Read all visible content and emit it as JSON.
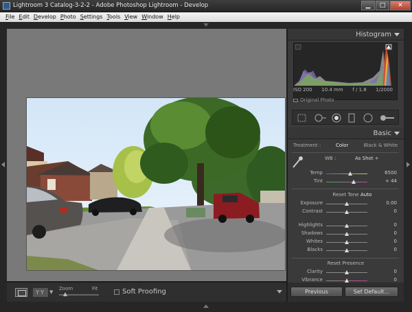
{
  "window": {
    "title": "Lightroom 3 Catalog-3-2-2 - Adobe Photoshop Lightroom - Develop",
    "minimize": "▁",
    "maximize": "□",
    "close": "✕"
  },
  "menu": [
    {
      "label": "File",
      "u": "F",
      "rest": "ile"
    },
    {
      "label": "Edit",
      "u": "E",
      "rest": "dit"
    },
    {
      "label": "Develop",
      "u": "D",
      "rest": "evelop"
    },
    {
      "label": "Photo",
      "u": "P",
      "rest": "hoto"
    },
    {
      "label": "Settings",
      "u": "S",
      "rest": "ettings"
    },
    {
      "label": "Tools",
      "u": "T",
      "rest": "ools"
    },
    {
      "label": "View",
      "u": "V",
      "rest": "iew"
    },
    {
      "label": "Window",
      "u": "W",
      "rest": "indow"
    },
    {
      "label": "Help",
      "u": "H",
      "rest": "elp"
    }
  ],
  "toolbar": {
    "yy_label": "YY",
    "zoom_label": "Zoom",
    "fit_label": "Fit",
    "soft_proofing": "Soft Proofing",
    "zoom_level": 0.1
  },
  "histogram": {
    "title": "Histogram",
    "iso": "ISO 200",
    "focal": "10.4 mm",
    "aperture": "f / 1.8",
    "shutter": "1/2000",
    "original_photo": "Original Photo"
  },
  "basic": {
    "title": "Basic",
    "treatment_label": "Treatment :",
    "color": "Color",
    "bw": "Black & White",
    "wb_label": "WB :",
    "wb_value": "As Shot ÷",
    "reset_tone": "Reset Tone",
    "auto": "Auto",
    "reset_presence": "Reset Presence",
    "sliders_wb": [
      {
        "label": "Temp",
        "value": "6500",
        "pos": 0.58
      },
      {
        "label": "Tint",
        "value": "+ 44",
        "pos": 0.66
      }
    ],
    "sliders_tone1": [
      {
        "label": "Exposure",
        "value": "0.00",
        "pos": 0.5
      },
      {
        "label": "Contrast",
        "value": "0",
        "pos": 0.5
      }
    ],
    "sliders_tone2": [
      {
        "label": "Highlights",
        "value": "0",
        "pos": 0.5
      },
      {
        "label": "Shadows",
        "value": "0",
        "pos": 0.5
      },
      {
        "label": "Whites",
        "value": "0",
        "pos": 0.5
      },
      {
        "label": "Blacks",
        "value": "0",
        "pos": 0.5
      }
    ],
    "sliders_presence": [
      {
        "label": "Clarity",
        "value": "0",
        "pos": 0.5
      },
      {
        "label": "Vibrance",
        "value": "0",
        "pos": 0.5
      }
    ]
  },
  "buttons": {
    "previous": "Previous",
    "set_default": "Set Default..."
  }
}
